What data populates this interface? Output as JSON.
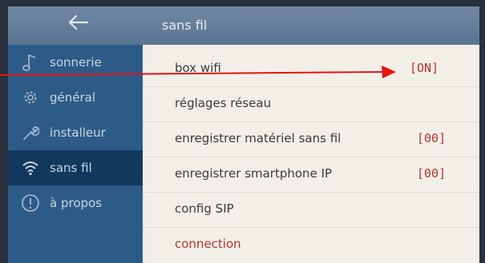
{
  "header": {
    "back_icon": "arrow-left-icon",
    "title": "sans fil"
  },
  "sidebar": {
    "items": [
      {
        "icon": "music-note-icon",
        "label": "sonnerie",
        "active": false
      },
      {
        "icon": "gear-icon",
        "label": "général",
        "active": false
      },
      {
        "icon": "wrench-icon",
        "label": "installeur",
        "active": false
      },
      {
        "icon": "wifi-icon",
        "label": "sans fil",
        "active": true
      },
      {
        "icon": "info-icon",
        "label": "à propos",
        "active": false
      }
    ]
  },
  "settings": {
    "rows": [
      {
        "label": "box wifi",
        "value": "[ON]"
      },
      {
        "label": "réglages réseau",
        "value": ""
      },
      {
        "label": "enregistrer matériel sans fil",
        "value": "[00]"
      },
      {
        "label": "enregistrer smartphone IP",
        "value": "[00]"
      },
      {
        "label": "config SIP",
        "value": ""
      },
      {
        "label": "connection",
        "value": ""
      }
    ]
  },
  "annotation": {
    "arrow_color": "#e01515"
  },
  "colors": {
    "accent_red": "#b6322b",
    "sidebar_bg": "#2d5b88",
    "sidebar_active": "#12385e",
    "panel_bg": "#f2efe9"
  }
}
